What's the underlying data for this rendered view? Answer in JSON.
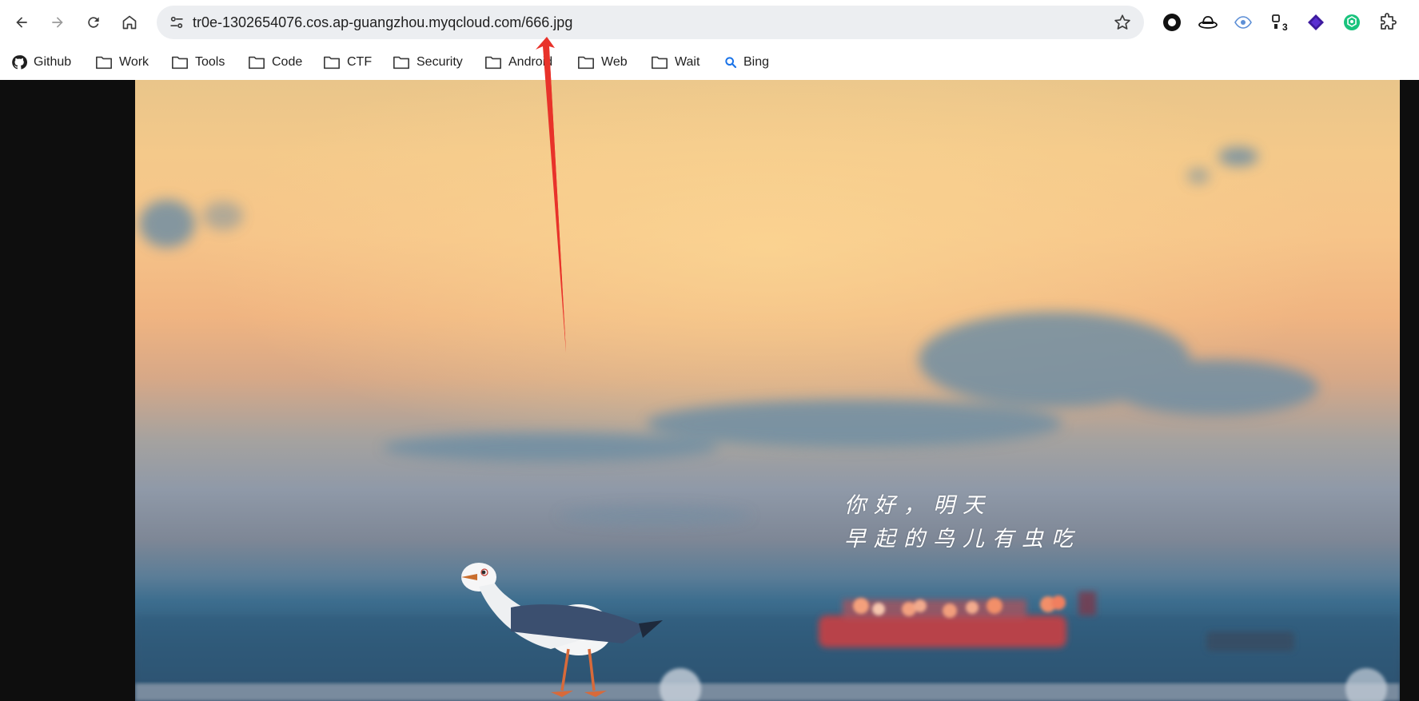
{
  "browser": {
    "url": "tr0e-1302654076.cos.ap-guangzhou.myqcloud.com/666.jpg",
    "nav": {
      "back_icon": "arrow-left-icon",
      "forward_icon": "arrow-right-icon",
      "reload_icon": "reload-icon",
      "home_icon": "home-icon"
    },
    "extensions": [
      {
        "name": "circle-extension-icon",
        "badge": ""
      },
      {
        "name": "hat-extension-icon",
        "badge": ""
      },
      {
        "name": "eye-extension-icon",
        "badge": ""
      },
      {
        "name": "puzzle-badge-extension-icon",
        "badge": "3"
      },
      {
        "name": "diamond-extension-icon",
        "badge": ""
      },
      {
        "name": "openai-extension-icon",
        "badge": ""
      },
      {
        "name": "extensions-puzzle-icon",
        "badge": ""
      }
    ]
  },
  "bookmarks": [
    {
      "label": "Github",
      "icon": "github-icon"
    },
    {
      "label": "Work",
      "icon": "folder-icon"
    },
    {
      "label": "Tools",
      "icon": "folder-icon"
    },
    {
      "label": "Code",
      "icon": "folder-icon"
    },
    {
      "label": "CTF",
      "icon": "folder-icon"
    },
    {
      "label": "Security",
      "icon": "folder-icon"
    },
    {
      "label": "Android",
      "icon": "folder-icon"
    },
    {
      "label": "Web",
      "icon": "folder-icon"
    },
    {
      "label": "Wait",
      "icon": "folder-icon"
    },
    {
      "label": "Bing",
      "icon": "search-icon"
    }
  ],
  "image": {
    "caption_line1": "你好，明天",
    "caption_line2": "早起的鸟儿有虫吃"
  },
  "colors": {
    "annotation_arrow": "#e8322a",
    "omnibox_bg": "#eceef1"
  }
}
